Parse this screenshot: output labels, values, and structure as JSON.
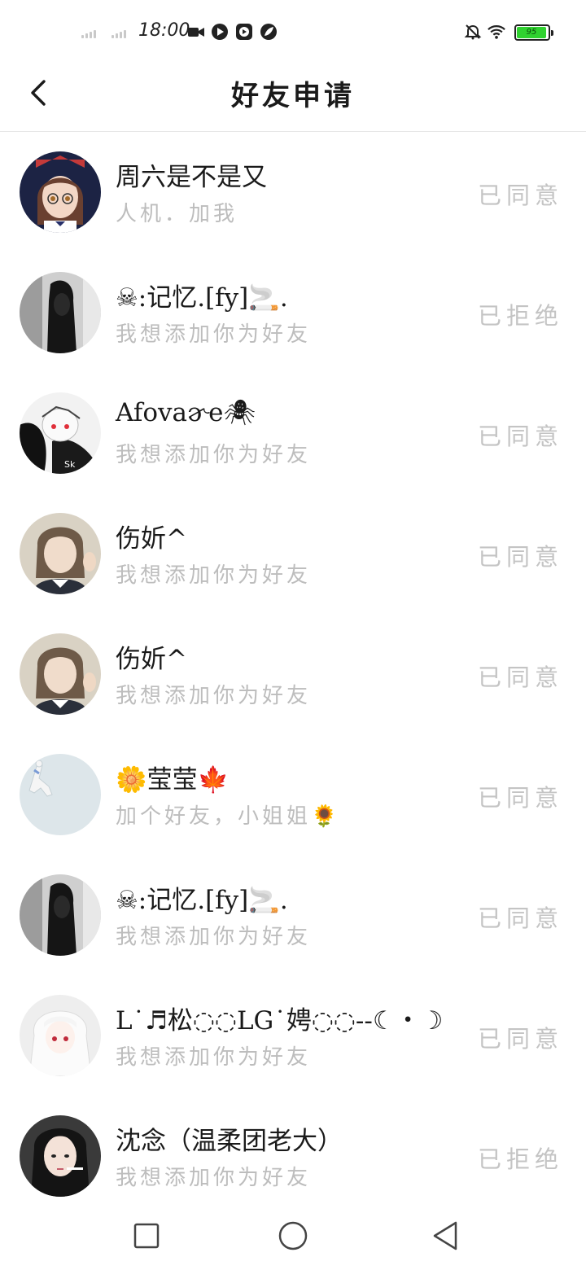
{
  "status_bar": {
    "time": "18:00",
    "battery": "95",
    "icons": [
      "signal-icon",
      "signal-icon",
      "video-icon",
      "play-icon",
      "media-icon",
      "leaf-icon",
      "mute-icon",
      "wifi-icon",
      "battery-icon"
    ],
    "battery_color": "#2fd12f"
  },
  "header": {
    "title": "好友申请",
    "back_icon": "back-arrow-icon"
  },
  "requests": [
    {
      "name": "周六是不是又",
      "message": "人机．加我",
      "status": "已同意"
    },
    {
      "name": "☠:记忆.[fy]🚬.",
      "message": "我想添加你为好友",
      "status": "已拒绝"
    },
    {
      "name": "Afovaɚe🕷",
      "message": "我想添加你为好友",
      "status": "已同意"
    },
    {
      "name": "伤妡^",
      "message": "我想添加你为好友",
      "status": "已同意"
    },
    {
      "name": "伤妡^",
      "message": "我想添加你为好友",
      "status": "已同意"
    },
    {
      "name": "🌼莹莹🍁",
      "message": "加个好友，小姐姐🌻",
      "status": "已同意"
    },
    {
      "name": "☠:记忆.[fy]🚬.",
      "message": "我想添加你为好友",
      "status": "已同意"
    },
    {
      "name": "L˙♬松◌◌LG˙娉◌◌--☾・☽",
      "message": "我想添加你为好友",
      "status": "已同意"
    },
    {
      "name": "沈念（温柔团老大）",
      "message": "我想添加你为好友",
      "status": "已拒绝"
    }
  ],
  "nav": {
    "icons": [
      "recent-apps-icon",
      "home-icon",
      "back-icon"
    ]
  },
  "colors": {
    "status_text": "#c4c4c4",
    "message_text": "#bdbdbd",
    "divider": "#e6e6e6"
  }
}
